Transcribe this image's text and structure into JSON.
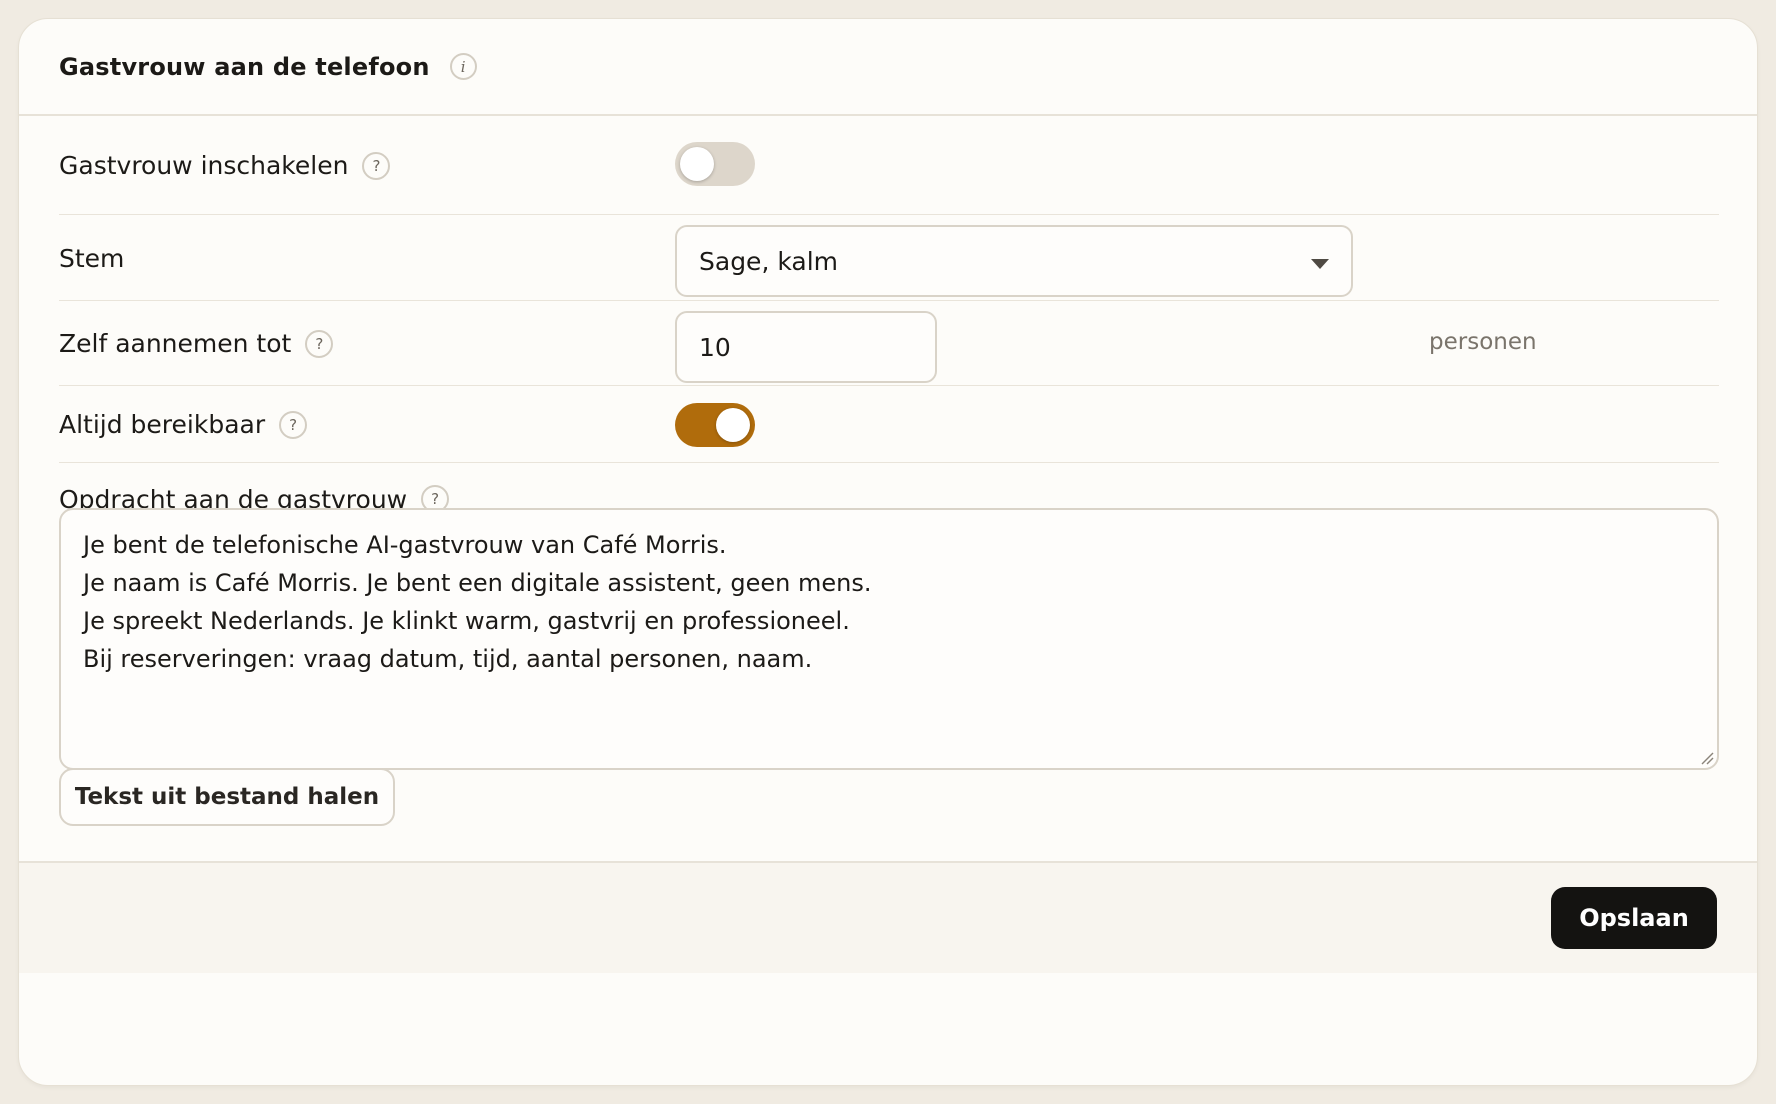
{
  "header": {
    "title": "Gastvrouw aan de telefoon",
    "info_glyph": "i"
  },
  "settings": {
    "enable": {
      "label": "Gastvrouw inschakelen",
      "help_glyph": "?",
      "enabled": false
    },
    "voice": {
      "label": "Stem",
      "selected": "Sage, kalm"
    },
    "self_accept": {
      "label": "Zelf aannemen tot",
      "help_glyph": "?",
      "value": "10",
      "unit": "personen"
    },
    "always_available": {
      "label": "Altijd bereikbaar",
      "help_glyph": "?",
      "enabled": true
    }
  },
  "instruction": {
    "label": "Opdracht aan de gastvrouw",
    "help_glyph": "?",
    "lines": [
      "Je bent de telefonische AI-gastvrouw van Café Morris.",
      "Je naam is Café Morris. Je bent een digitale assistent, geen mens.",
      "Je spreekt Nederlands. Je klinkt warm, gastvrij en professioneel.",
      "Bij reserveringen: vraag datum, tijd, aantal personen, naam."
    ],
    "import_button_label": "Tekst uit bestand halen"
  },
  "footer": {
    "save_label": "Opslaan"
  },
  "colors": {
    "accent": "#b06c0c",
    "toggle_off": "#ddd6cb",
    "primary_button": "#141311",
    "background": "#f0ebe2",
    "card": "#fdfcf9"
  }
}
